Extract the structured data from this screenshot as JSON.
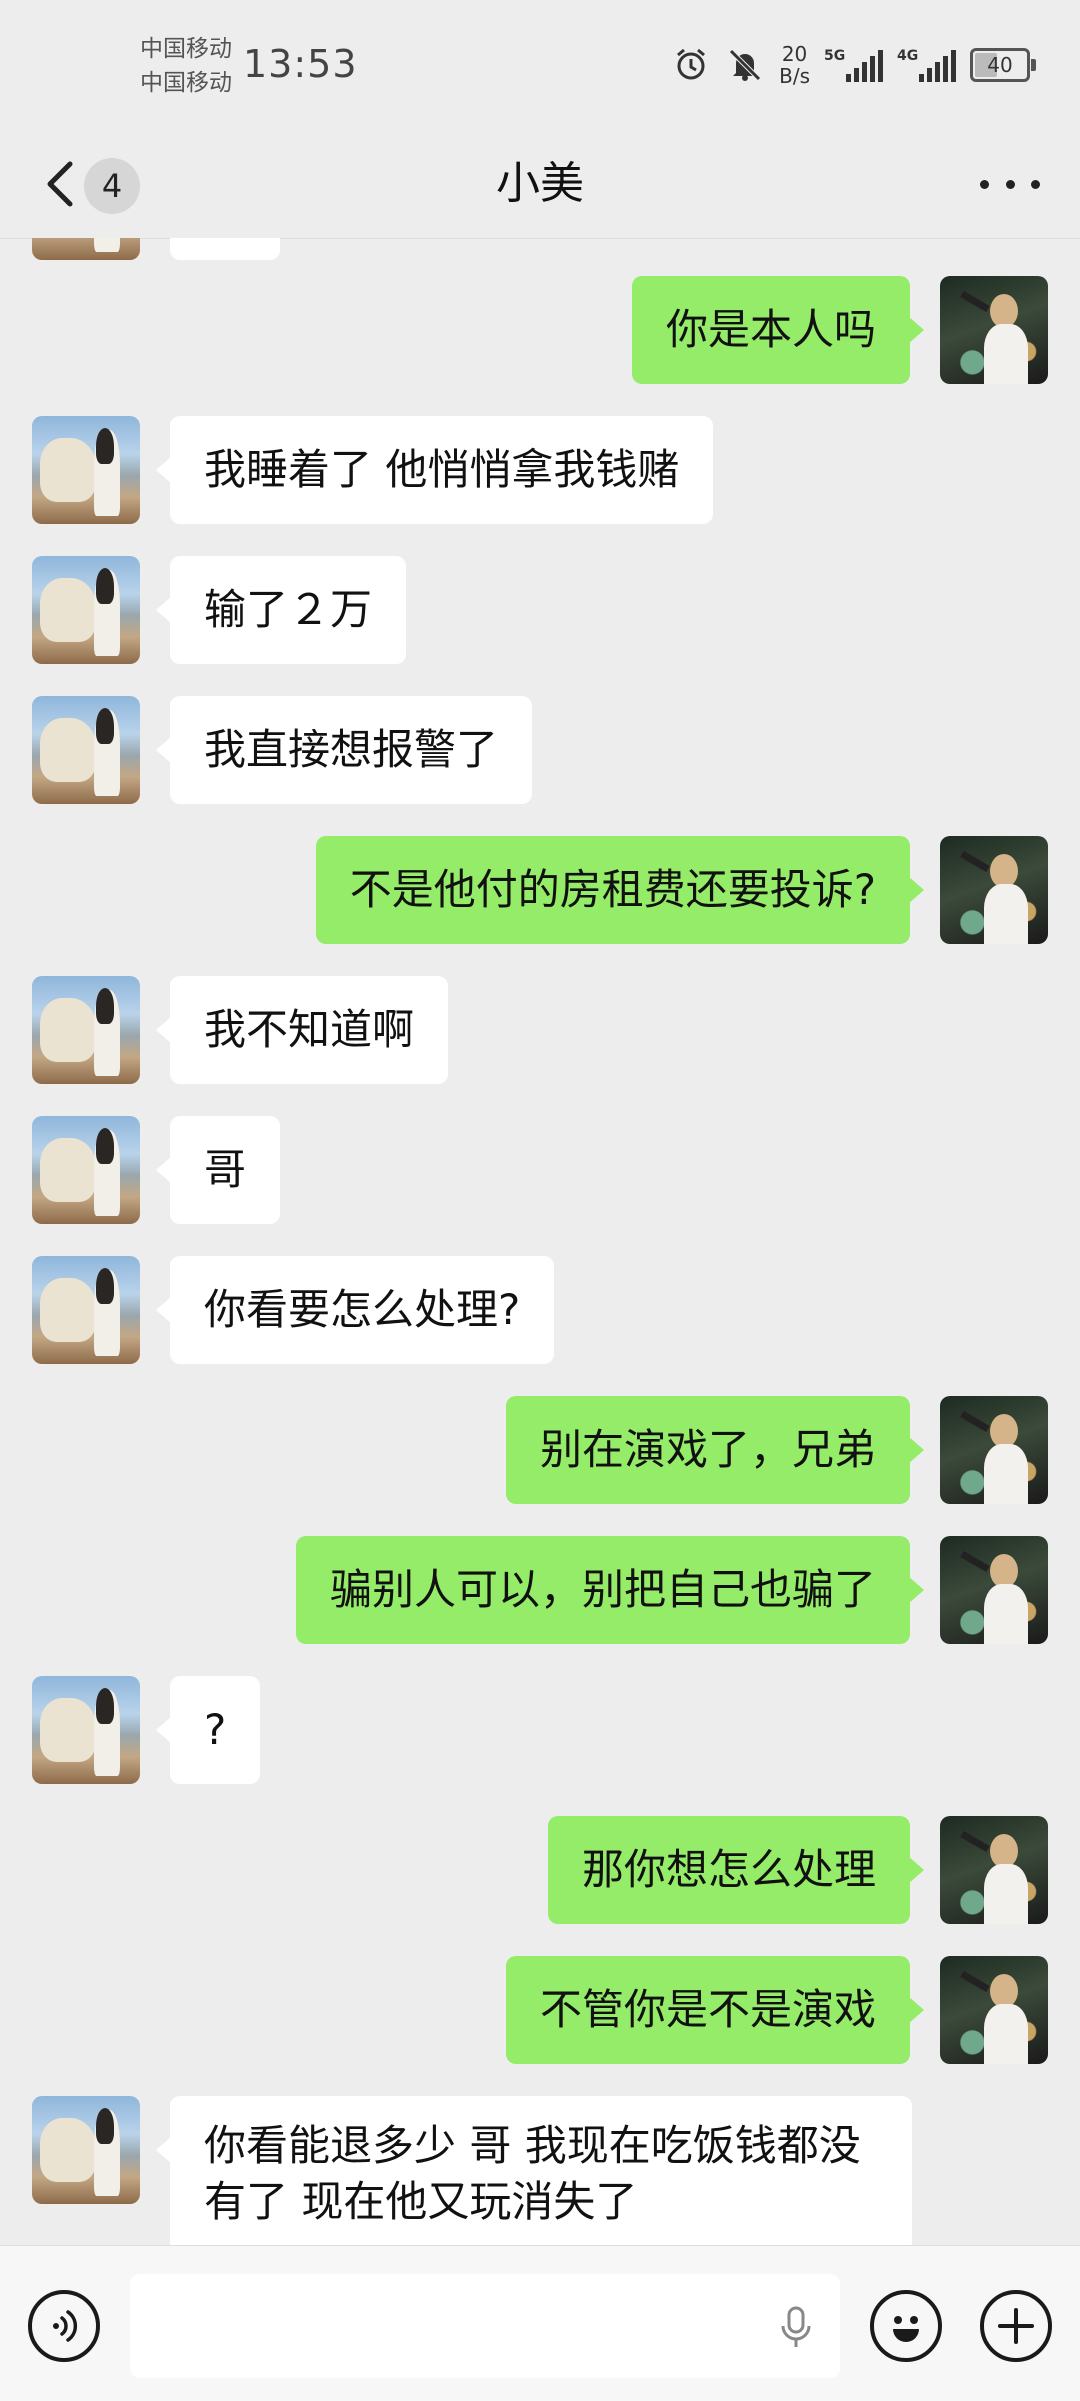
{
  "status_bar": {
    "carrier_1": "中国移动",
    "carrier_2": "中国移动",
    "time": "13:53",
    "net_speed_value": "20",
    "net_speed_unit": "B/s",
    "signal_1_label": "5G",
    "signal_2_label": "4G",
    "battery": "40",
    "icons": [
      "alarm-icon",
      "mute-bell-icon",
      "signal-5g-icon",
      "signal-4g-icon",
      "battery-icon"
    ]
  },
  "header": {
    "title": "小美",
    "unread_count": "4",
    "back_icon": "chevron-left-icon",
    "more_icon": "more-dots-icon"
  },
  "messages": [
    {
      "side": "right",
      "text": "你是本人吗"
    },
    {
      "side": "left",
      "text": "我睡着了 他悄悄拿我钱赌"
    },
    {
      "side": "left",
      "text": "输了２万"
    },
    {
      "side": "left",
      "text": "我直接想报警了"
    },
    {
      "side": "right",
      "text": "不是他付的房租费还要投诉?"
    },
    {
      "side": "left",
      "text": "我不知道啊"
    },
    {
      "side": "left",
      "text": "哥"
    },
    {
      "side": "left",
      "text": "你看要怎么处理?"
    },
    {
      "side": "right",
      "text": "别在演戏了，兄弟"
    },
    {
      "side": "right",
      "text": "骗别人可以，别把自己也骗了"
    },
    {
      "side": "left",
      "text": "?"
    },
    {
      "side": "right",
      "text": "那你想怎么处理"
    },
    {
      "side": "right",
      "text": "不管你是不是演戏"
    },
    {
      "side": "left",
      "text": "你看能退多少 哥 我现在吃饭钱都没有了 现在他又玩消失了"
    }
  ],
  "input_bar": {
    "text_value": "",
    "icons": [
      "voice-icon",
      "mic-icon",
      "emoji-icon",
      "plus-icon"
    ]
  },
  "colors": {
    "background": "#ededed",
    "sent_bubble": "#95ec69",
    "received_bubble": "#ffffff"
  }
}
